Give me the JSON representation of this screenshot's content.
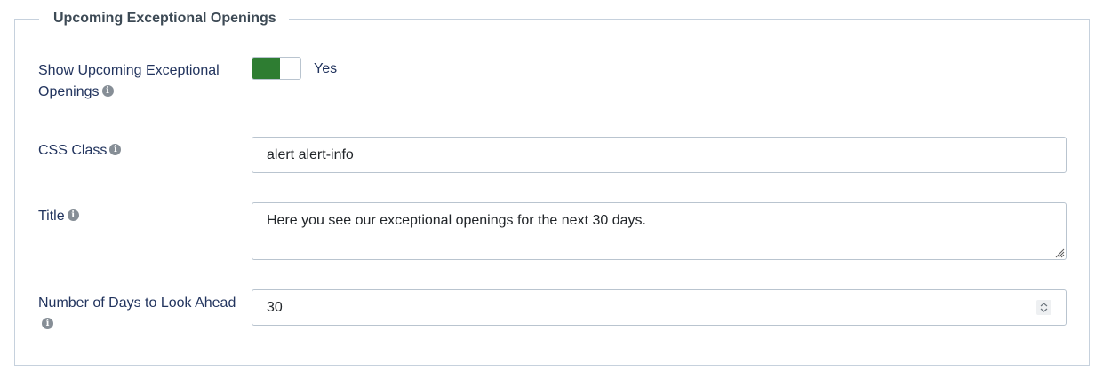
{
  "fieldset": {
    "legend": "Upcoming Exceptional Openings"
  },
  "show_upcoming": {
    "label_line1": "Show Upcoming Exceptional",
    "label_line2": "Openings",
    "toggle_text": "Yes",
    "toggle_on": true,
    "toggle_color": "#2e7d32"
  },
  "css_class": {
    "label": "CSS Class",
    "value": "alert alert-info"
  },
  "title_field": {
    "label": "Title",
    "value": "Here you see our exceptional openings for the next 30 days."
  },
  "days_ahead": {
    "label": "Number of Days to Look Ahead",
    "value": "30"
  },
  "icons": {
    "info": "info-icon",
    "spinner": "spinner-arrows-icon",
    "resize": "resize-grip-icon"
  }
}
